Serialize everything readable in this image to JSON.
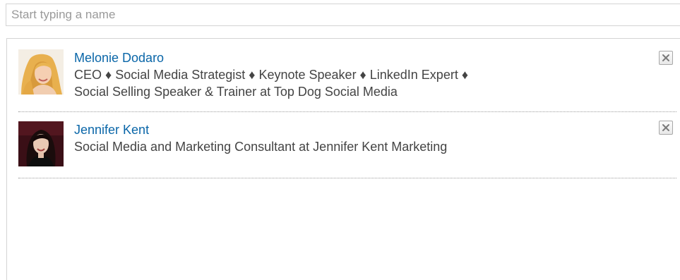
{
  "search": {
    "placeholder": "Start typing a name",
    "value": ""
  },
  "results": [
    {
      "name": "Melonie Dodaro",
      "headline_lines": [
        "CEO ♦ Social Media Strategist ♦ Keynote Speaker ♦ LinkedIn Expert ♦",
        "Social Selling Speaker & Trainer at Top Dog Social Media"
      ],
      "avatar_icon": "person-photo-blonde",
      "remove_icon": "close-icon"
    },
    {
      "name": "Jennifer Kent",
      "headline_lines": [
        "Social Media and Marketing Consultant at Jennifer Kent Marketing"
      ],
      "avatar_icon": "person-photo-dark-hair",
      "remove_icon": "close-icon"
    }
  ],
  "colors": {
    "link": "#0a66a8",
    "text": "#444444",
    "placeholder": "#9a9a9a",
    "border": "#d4d4d4",
    "divider": "#9c9c9c"
  }
}
